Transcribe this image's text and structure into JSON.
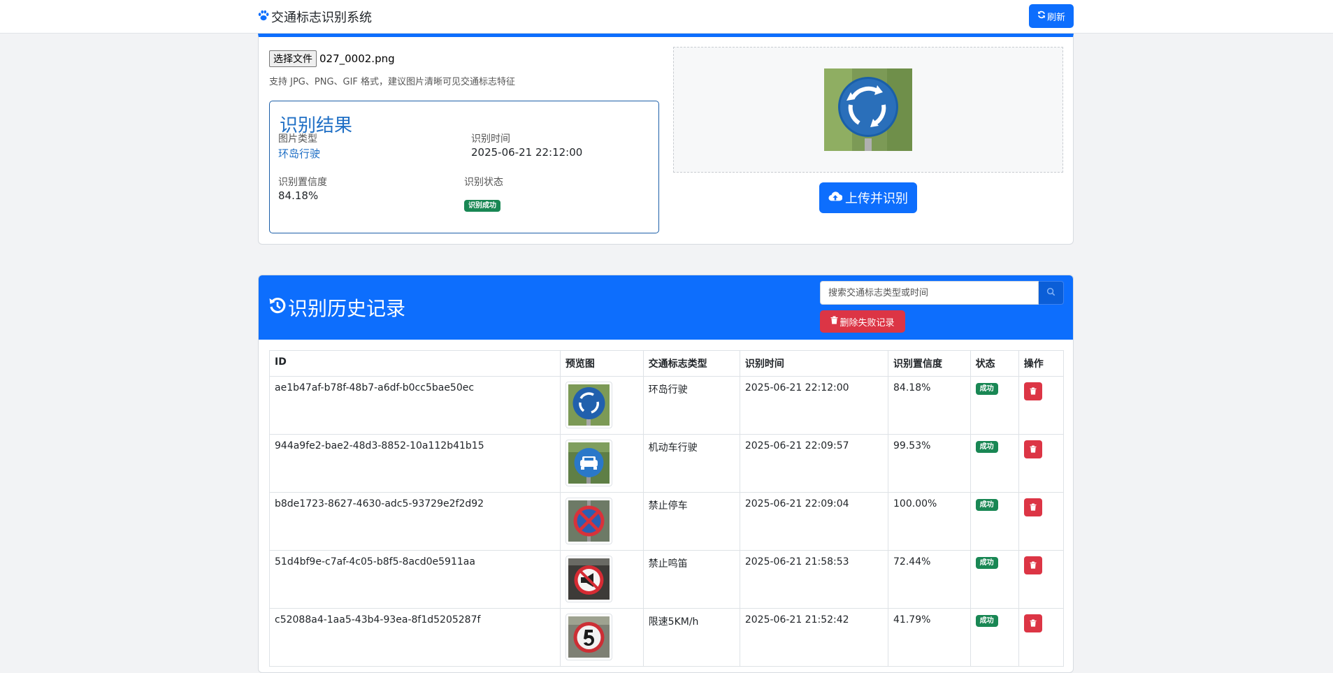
{
  "navbar": {
    "brand_icon": "paw-icon",
    "brand_title": "交通标志识别系统",
    "refresh_icon": "refresh-icon",
    "refresh_label": "刷新"
  },
  "upload": {
    "file_button_label": "选择文件",
    "file_name": "027_0002.png",
    "hint": "支持 JPG、PNG、GIF 格式，建议图片清晰可见交通标志特征",
    "upload_icon": "cloud-upload-icon",
    "upload_button_label": "上传并识别"
  },
  "result": {
    "title": "识别结果",
    "type_label": "图片类型",
    "type_value": "环岛行驶",
    "time_label": "识别时间",
    "time_value": "2025-06-21 22:12:00",
    "confidence_label": "识别置信度",
    "confidence_value": "84.18%",
    "status_label": "识别状态",
    "status_value": "识别成功"
  },
  "history": {
    "title_icon": "history-icon",
    "title": "识别历史记录",
    "search_placeholder": "搜索交通标志类型或时间",
    "search_icon": "search-icon",
    "delete_failed_icon": "trash-icon",
    "delete_failed_label": "删除失败记录",
    "columns": [
      "ID",
      "预览图",
      "交通标志类型",
      "识别时间",
      "识别置信度",
      "状态",
      "操作"
    ],
    "rows": [
      {
        "id": "ae1b47af-b78f-48b7-a6df-b0cc5bae50ec",
        "type": "环岛行驶",
        "time": "2025-06-21 22:12:00",
        "confidence": "84.18%",
        "status": "成功",
        "thumb_icon": "roundabout-sign-icon"
      },
      {
        "id": "944a9fe2-bae2-48d3-8852-10a112b41b15",
        "type": "机动车行驶",
        "time": "2025-06-21 22:09:57",
        "confidence": "99.53%",
        "status": "成功",
        "thumb_icon": "motor-vehicle-sign-icon"
      },
      {
        "id": "b8de1723-8627-4630-adc5-93729e2f2d92",
        "type": "禁止停车",
        "time": "2025-06-21 22:09:04",
        "confidence": "100.00%",
        "status": "成功",
        "thumb_icon": "no-parking-sign-icon"
      },
      {
        "id": "51d4bf9e-c7af-4c05-b8f5-8acd0e5911aa",
        "type": "禁止鸣笛",
        "time": "2025-06-21 21:58:53",
        "confidence": "72.44%",
        "status": "成功",
        "thumb_icon": "no-honking-sign-icon"
      },
      {
        "id": "c52088a4-1aa5-43b4-93ea-8f1d5205287f",
        "type": "限速5KM/h",
        "time": "2025-06-21 21:52:42",
        "confidence": "41.79%",
        "status": "成功",
        "thumb_icon": "speed-limit-5-sign-icon"
      }
    ],
    "row_delete_icon": "trash-icon"
  },
  "colors": {
    "primary": "#0d6efd",
    "danger": "#dc3545",
    "success": "#198754",
    "result_accent": "#1f6fc5"
  }
}
